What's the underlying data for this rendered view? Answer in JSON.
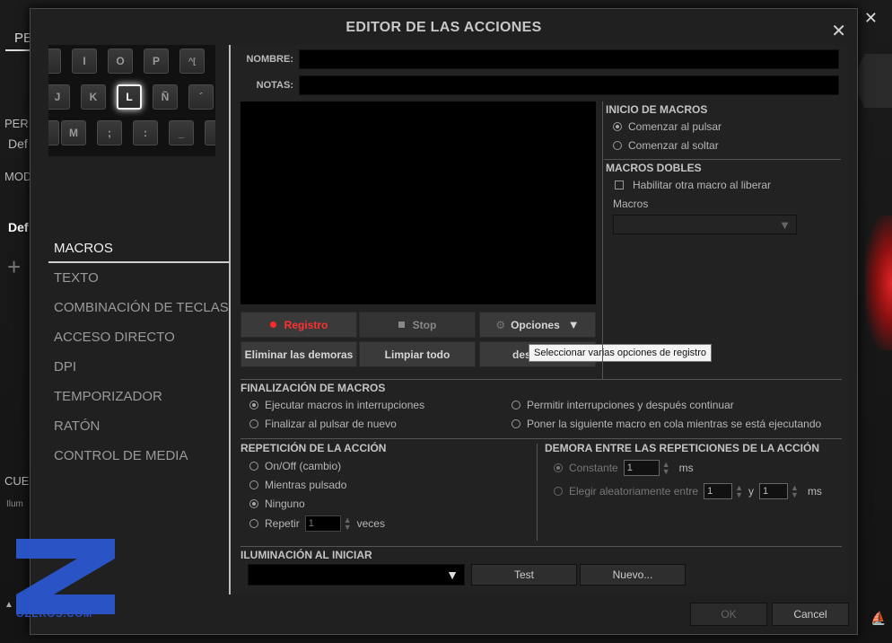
{
  "background": {
    "left_labels": [
      "PE",
      "PER",
      "Def",
      "MOD",
      "Def",
      "CUE",
      "Ilum"
    ]
  },
  "dialog": {
    "title": "EDITOR DE LAS ACCIONES",
    "close_glyph": "✕"
  },
  "keyboard": {
    "keys_row1": [
      "I",
      "O",
      "P",
      "^["
    ],
    "keys_row2": [
      "J",
      "K",
      "L",
      "Ñ",
      "´"
    ],
    "keys_row3": [
      "M",
      ";",
      ":",
      "_"
    ],
    "selected_key": "L"
  },
  "nav": {
    "items": [
      {
        "label": "MACROS",
        "active": true
      },
      {
        "label": "TEXTO"
      },
      {
        "label": "COMBINACIÓN DE TECLAS"
      },
      {
        "label": "ACCESO DIRECTO"
      },
      {
        "label": "DPI"
      },
      {
        "label": "TEMPORIZADOR"
      },
      {
        "label": "RATÓN"
      },
      {
        "label": "CONTROL DE MEDIA"
      }
    ]
  },
  "form": {
    "name_label": "NOMBRE:",
    "name_value": "",
    "notes_label": "NOTAS:",
    "notes_value": ""
  },
  "macro_buttons": {
    "record": "Registro",
    "stop": "Stop",
    "options": "Opciones",
    "remove_delays": "Eliminar las demoras",
    "clear_all": "Limpiar todo",
    "third": "des"
  },
  "tooltip": "Seleccionar varias opciones de registro",
  "macro_start": {
    "title": "INICIO DE MACROS",
    "options": [
      "Comenzar al pulsar",
      "Comenzar al soltar"
    ],
    "selected": 0
  },
  "double_macros": {
    "title": "MACROS DOBLES",
    "checkbox": "Habilitar otra macro al liberar",
    "macros_label": "Macros"
  },
  "finalization": {
    "title": "FINALIZACIÓN DE MACROS",
    "options": [
      "Ejecutar macros in interrupciones",
      "Finalizar al pulsar de nuevo",
      "Permitir interrupciones y después continuar",
      "Poner la siguiente macro en cola mientras se está ejecutando"
    ],
    "selected": 0
  },
  "repetition": {
    "title": "REPETICIÓN DE LA ACCIÓN",
    "options": [
      "On/Off (cambio)",
      "Mientras pulsado",
      "Ninguno",
      "Repetir"
    ],
    "selected": 2,
    "repeat_value": "1",
    "repeat_unit": "veces"
  },
  "delay": {
    "title": "DEMORA ENTRE LAS REPETICIONES DE LA ACCIÓN",
    "constant_label": "Constante",
    "constant_value": "1",
    "unit": "ms",
    "random_label": "Elegir aleatoriamente entre",
    "random_min": "1",
    "and_label": "y",
    "random_max": "1"
  },
  "lighting": {
    "title": "ILUMINACIÓN AL INICIAR",
    "test": "Test",
    "new": "Nuevo..."
  },
  "footer": {
    "ok": "OK",
    "cancel": "Cancel"
  },
  "watermark": "OZEROS.COM"
}
